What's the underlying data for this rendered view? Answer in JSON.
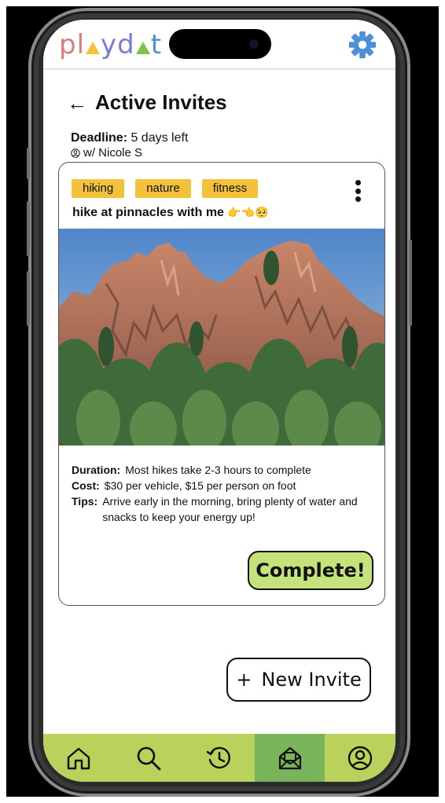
{
  "header": {
    "logo_letters": [
      {
        "char": "p",
        "color": "#e07a7a"
      },
      {
        "char": "l",
        "color": "#e07a7a"
      },
      {
        "char": "y",
        "color": "#7a7ad8"
      },
      {
        "char": "d",
        "color": "#7a7ad8"
      },
      {
        "char": "t",
        "color": "#4e8fd8"
      }
    ],
    "logo_triangles": [
      "#f3c13a",
      "#7cc24d"
    ],
    "settings_icon": "gear-icon",
    "settings_color": "#4e8fd8"
  },
  "page": {
    "back_symbol": "←",
    "title": "Active Invites",
    "deadline_label": "Deadline:",
    "deadline_value": " 5 days left",
    "partner": "w/ Nicole S"
  },
  "invite": {
    "tags": [
      "hiking",
      "nature",
      "fitness"
    ],
    "title": "hike at pinnacles with me",
    "title_emoji": "👉👈🥺",
    "image": "pinnacles-rock-formation-photo",
    "details": [
      {
        "label": "Duration:",
        "value": "Most hikes take 2-3 hours to complete"
      },
      {
        "label": "Cost:",
        "value": "$30 per vehicle, $15 per person on foot"
      },
      {
        "label": "Tips:",
        "value": "Arrive early in the morning, bring plenty of water and snacks to keep your energy up!"
      }
    ],
    "complete_label": "Complete!"
  },
  "new_invite": {
    "plus": "+",
    "label": "New Invite"
  },
  "nav": {
    "items": [
      "home-icon",
      "search-icon",
      "history-icon",
      "inbox-icon",
      "profile-icon"
    ],
    "active_index": 3,
    "bar_color": "#b9d25b",
    "active_color": "#79b45a"
  }
}
